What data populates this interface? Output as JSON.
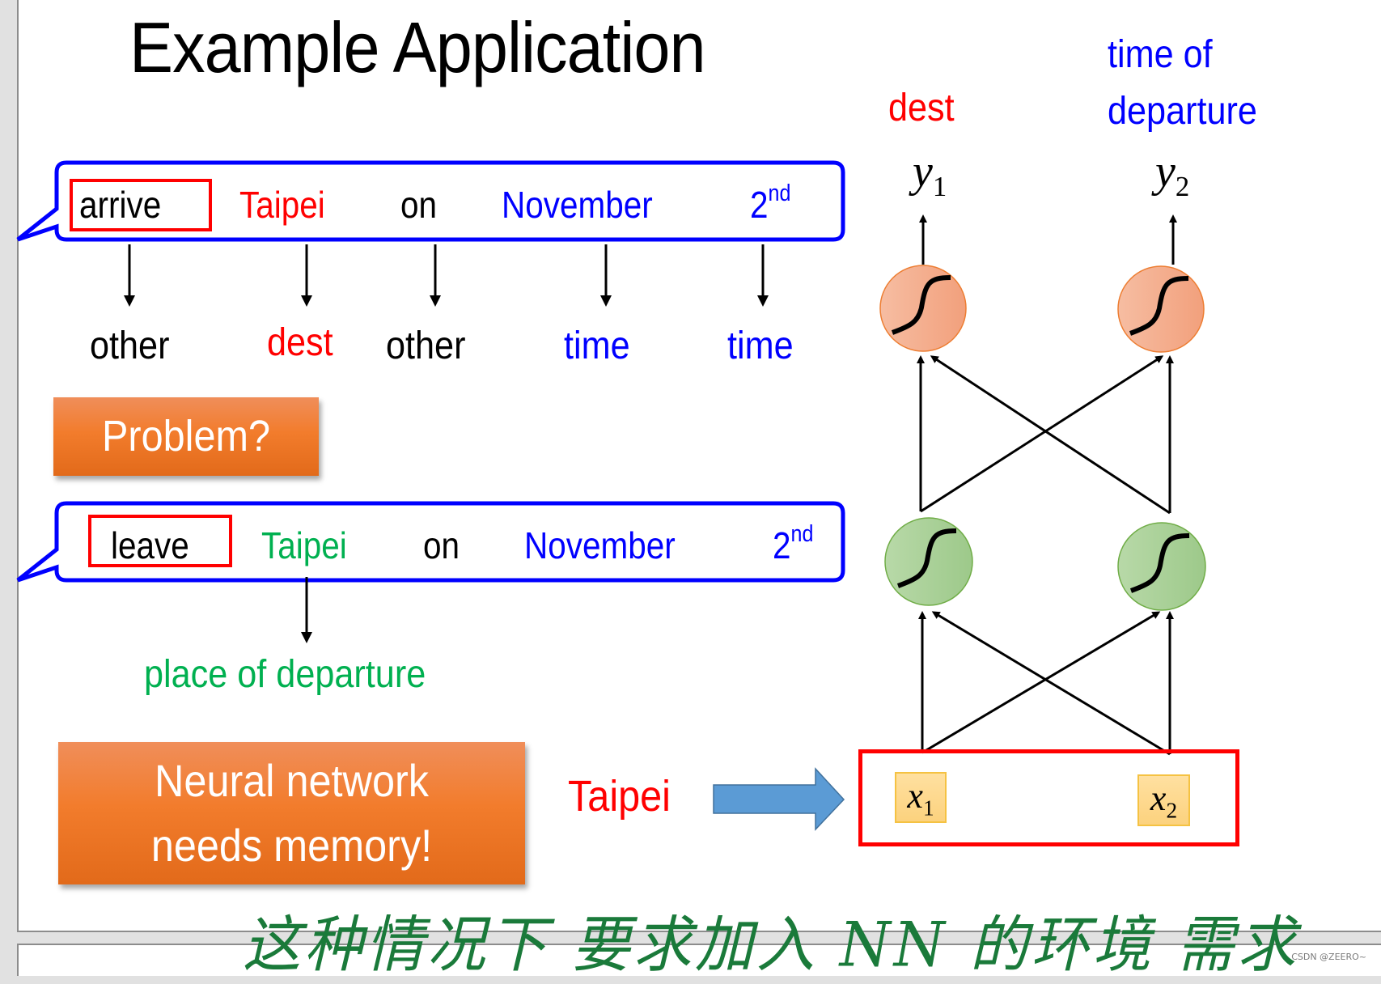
{
  "slide": {
    "title": "Example Application",
    "sentence_1": {
      "words": [
        {
          "text": "arrive",
          "color": "#000000",
          "highlighted": true
        },
        {
          "text": "Taipei",
          "color": "#ff0000"
        },
        {
          "text": "on",
          "color": "#000000"
        },
        {
          "text": "November",
          "color": "#0000ff"
        },
        {
          "text": "2",
          "sup": "nd",
          "color": "#0000ff"
        }
      ],
      "slot_labels": [
        {
          "text": "other",
          "color": "#000000"
        },
        {
          "text": "dest",
          "color": "#ff0000"
        },
        {
          "text": "other",
          "color": "#000000"
        },
        {
          "text": "time",
          "color": "#0000ff"
        },
        {
          "text": "time",
          "color": "#0000ff"
        }
      ]
    },
    "problem_button": "Problem?",
    "sentence_2": {
      "words": [
        {
          "text": "leave",
          "color": "#000000",
          "highlighted": true
        },
        {
          "text": "Taipei",
          "color": "#00b050"
        },
        {
          "text": "on",
          "color": "#000000"
        },
        {
          "text": "November",
          "color": "#0000ff"
        },
        {
          "text": "2",
          "sup": "nd",
          "color": "#0000ff"
        }
      ],
      "slot_label": {
        "text": "place of departure",
        "color": "#00b050"
      }
    },
    "memory_box": {
      "line1": "Neural network",
      "line2": "needs memory!"
    },
    "input_word": "Taipei",
    "network": {
      "outputs": [
        {
          "name": "dest",
          "color": "#ff0000",
          "symbol": "y",
          "sub": "1"
        },
        {
          "name_line1": "time of",
          "name_line2": "departure",
          "color": "#0000ff",
          "symbol": "y",
          "sub": "2"
        }
      ],
      "inputs": [
        {
          "symbol": "x",
          "sub": "1"
        },
        {
          "symbol": "x",
          "sub": "2"
        }
      ],
      "hidden_layer_color": "#a9d18e",
      "output_layer_color": "#f4b183"
    },
    "handwritten_note": "这种情况下 要求加入 NN 的环境 需求"
  },
  "watermark": "CSDN @ZEERO~"
}
